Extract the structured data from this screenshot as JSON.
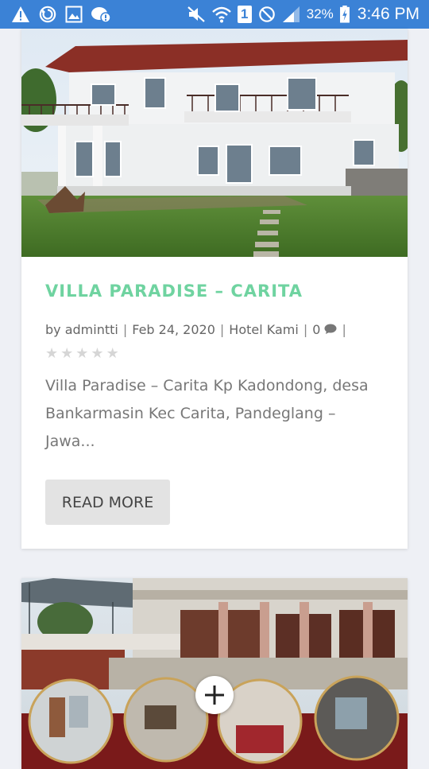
{
  "status_bar": {
    "battery_percent": "32%",
    "time": "3:46 PM",
    "sim_badge": "1",
    "icons": [
      "warning-icon",
      "sync-icon",
      "image-icon",
      "chat-icon",
      "mute-icon",
      "wifi-icon",
      "sim-icon",
      "do-not-disturb-icon",
      "signal-icon",
      "battery-icon"
    ]
  },
  "post1": {
    "title": "VILLA PARADISE – CARITA",
    "meta": {
      "by": "by",
      "author": "admintti",
      "date": "Feb 24, 2020",
      "category": "Hotel Kami",
      "comments": "0",
      "trailing_sep": "|"
    },
    "rating": 0,
    "excerpt": "Villa Paradise – Carita Kp Kadondong, desa Bankarmasin Kec Carita, Pandeglang – Jawa...",
    "read_more": "READ MORE"
  },
  "colors": {
    "title": "#6fd3a0",
    "status_bar": "#3b82d6",
    "banner": "#7a1a1a"
  }
}
